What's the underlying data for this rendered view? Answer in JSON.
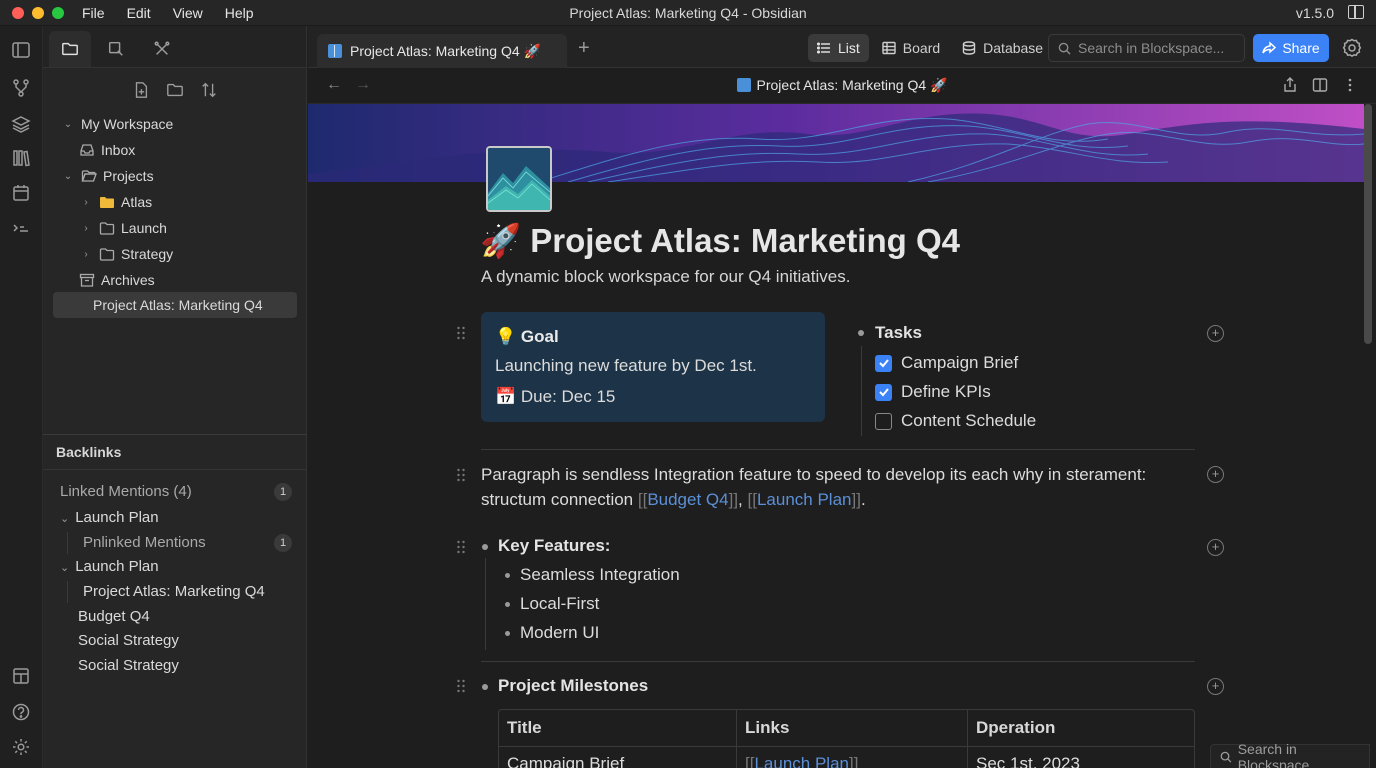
{
  "window": {
    "title": "Project Atlas: Marketing Q4 - Obsidian",
    "version": "v1.5.0",
    "menu": [
      "File",
      "Edit",
      "View",
      "Help"
    ]
  },
  "ribbon": {
    "icons": [
      "sidebar-toggle-icon",
      "graph-icon",
      "layers-icon",
      "library-icon",
      "calendar-icon",
      "command-icon",
      "template-icon",
      "help-icon",
      "settings-icon"
    ]
  },
  "sidebar": {
    "tabs": [
      "files-icon",
      "search-icon",
      "bookmarks-icon"
    ],
    "actions": [
      "new-note-icon",
      "new-folder-icon",
      "sort-icon"
    ],
    "tree": [
      {
        "label": "My Workspace"
      },
      {
        "label": "Inbox"
      },
      {
        "label": "Projects"
      },
      {
        "label": "Atlas"
      },
      {
        "label": "Launch"
      },
      {
        "label": "Strategy"
      },
      {
        "label": "Archives"
      },
      {
        "label": "Project Atlas: Marketing Q4"
      }
    ]
  },
  "backlinks": {
    "header": "Backlinks",
    "linked_mentions": "Linked Mentions (4)",
    "linked_count": "1",
    "items": [
      {
        "label": "Launch Plan"
      },
      {
        "label": "Pnlinked Mentions",
        "count": "1"
      },
      {
        "label": "Launch Plan"
      },
      {
        "label": "Project Atlas: Marketing Q4"
      },
      {
        "label": "Budget Q4"
      },
      {
        "label": "Social Strategy"
      },
      {
        "label": "Social Strategy"
      }
    ]
  },
  "tabbar": {
    "doc_tab": "Project Atlas: Marketing Q4 🚀",
    "views": [
      {
        "label": "List"
      },
      {
        "label": "Board"
      },
      {
        "label": "Database"
      }
    ],
    "search_placeholder": "Search in Blockspace...",
    "share_label": "Share"
  },
  "nav": {
    "title": "Project Atlas: Marketing Q4 🚀"
  },
  "page": {
    "title": "🚀 Project Atlas: Marketing Q4",
    "subtitle": "A dynamic block workspace for our Q4 initiatives.",
    "goal": {
      "title": "💡 Goal",
      "line1": "Launching new feature by Dec 1st.",
      "line2": "📅 Due: Dec 15"
    },
    "tasks": {
      "title": "Tasks",
      "items": [
        {
          "label": "Campaign Brief",
          "checked": true
        },
        {
          "label": "Define KPIs",
          "checked": true
        },
        {
          "label": "Content Schedule",
          "checked": false
        }
      ]
    },
    "paragraph": {
      "text1": "Paragraph is sendless Integration feature to speed to develop its each why in sterament: structum connection ",
      "link1": "Budget Q4",
      "sep": ", ",
      "link2": "Launch Plan",
      "end": "."
    },
    "features": {
      "title": "Key Features:",
      "items": [
        "Seamless Integration",
        "Local-First",
        "Modern UI"
      ]
    },
    "milestones": {
      "title": "Project Milestones",
      "headers": [
        "Title",
        "Links",
        "Dperation"
      ],
      "rows": [
        [
          "Campaign Brief",
          "Launch Plan",
          "Sec 1st, 2023"
        ]
      ]
    }
  },
  "footer": {
    "search_label": "Search in Blockspace"
  }
}
